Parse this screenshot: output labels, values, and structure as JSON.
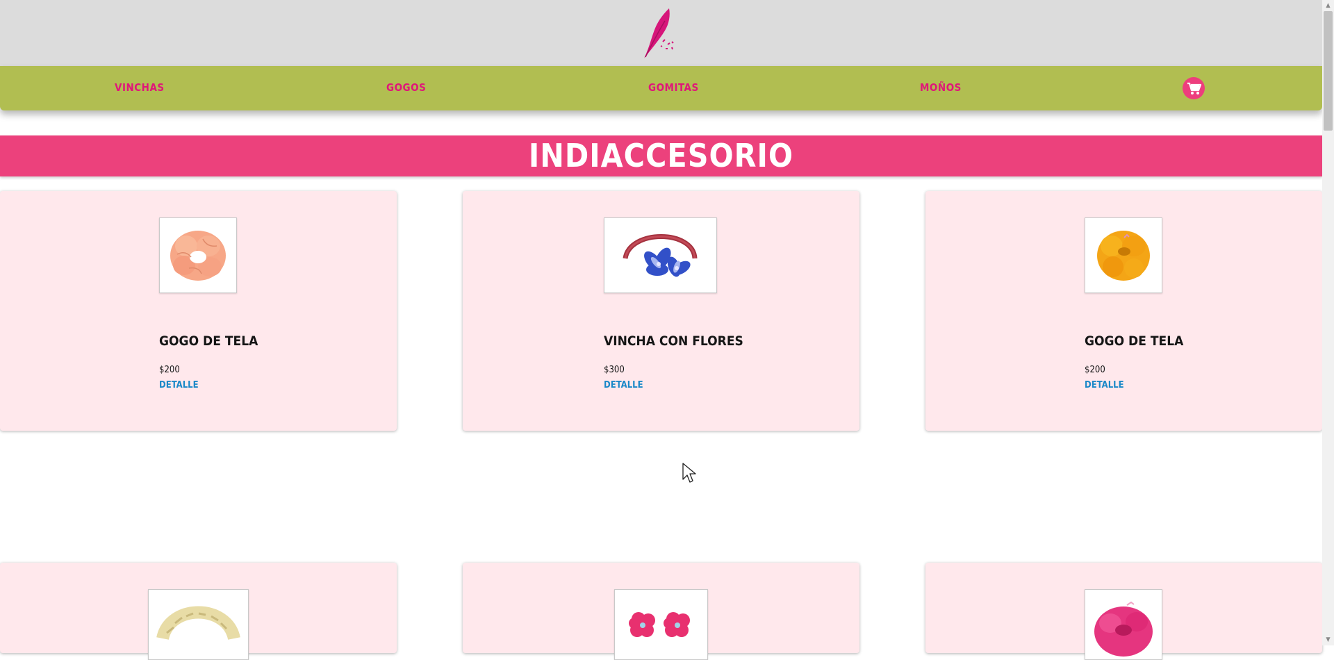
{
  "header": {
    "logo_icon": "feather-logo-icon"
  },
  "nav": {
    "items": [
      {
        "label": "VINCHAS"
      },
      {
        "label": "GOGOS"
      },
      {
        "label": "GOMITAS"
      },
      {
        "label": "MOÑOS"
      }
    ],
    "cart_icon": "cart-icon",
    "background": "#b1be51",
    "link_color": "#e0167a"
  },
  "banner": {
    "title": "INDIACCESORIO",
    "background": "#ec417c"
  },
  "products": [
    {
      "title": "GOGO DE TELA",
      "price": "$200",
      "detail": "DETALLE",
      "image": "peach-scrunchie"
    },
    {
      "title": "VINCHA CON FLORES",
      "price": "$300",
      "detail": "DETALLE",
      "image": "headband-blue-flowers"
    },
    {
      "title": "GOGO DE TELA",
      "price": "$200",
      "detail": "DETALLE",
      "image": "yellow-scrunchie"
    },
    {
      "title": "",
      "price": "",
      "detail": "",
      "image": "braided-headband"
    },
    {
      "title": "",
      "price": "",
      "detail": "",
      "image": "pink-flower-clips"
    },
    {
      "title": "",
      "price": "",
      "detail": "",
      "image": "pink-scrunchie"
    }
  ]
}
